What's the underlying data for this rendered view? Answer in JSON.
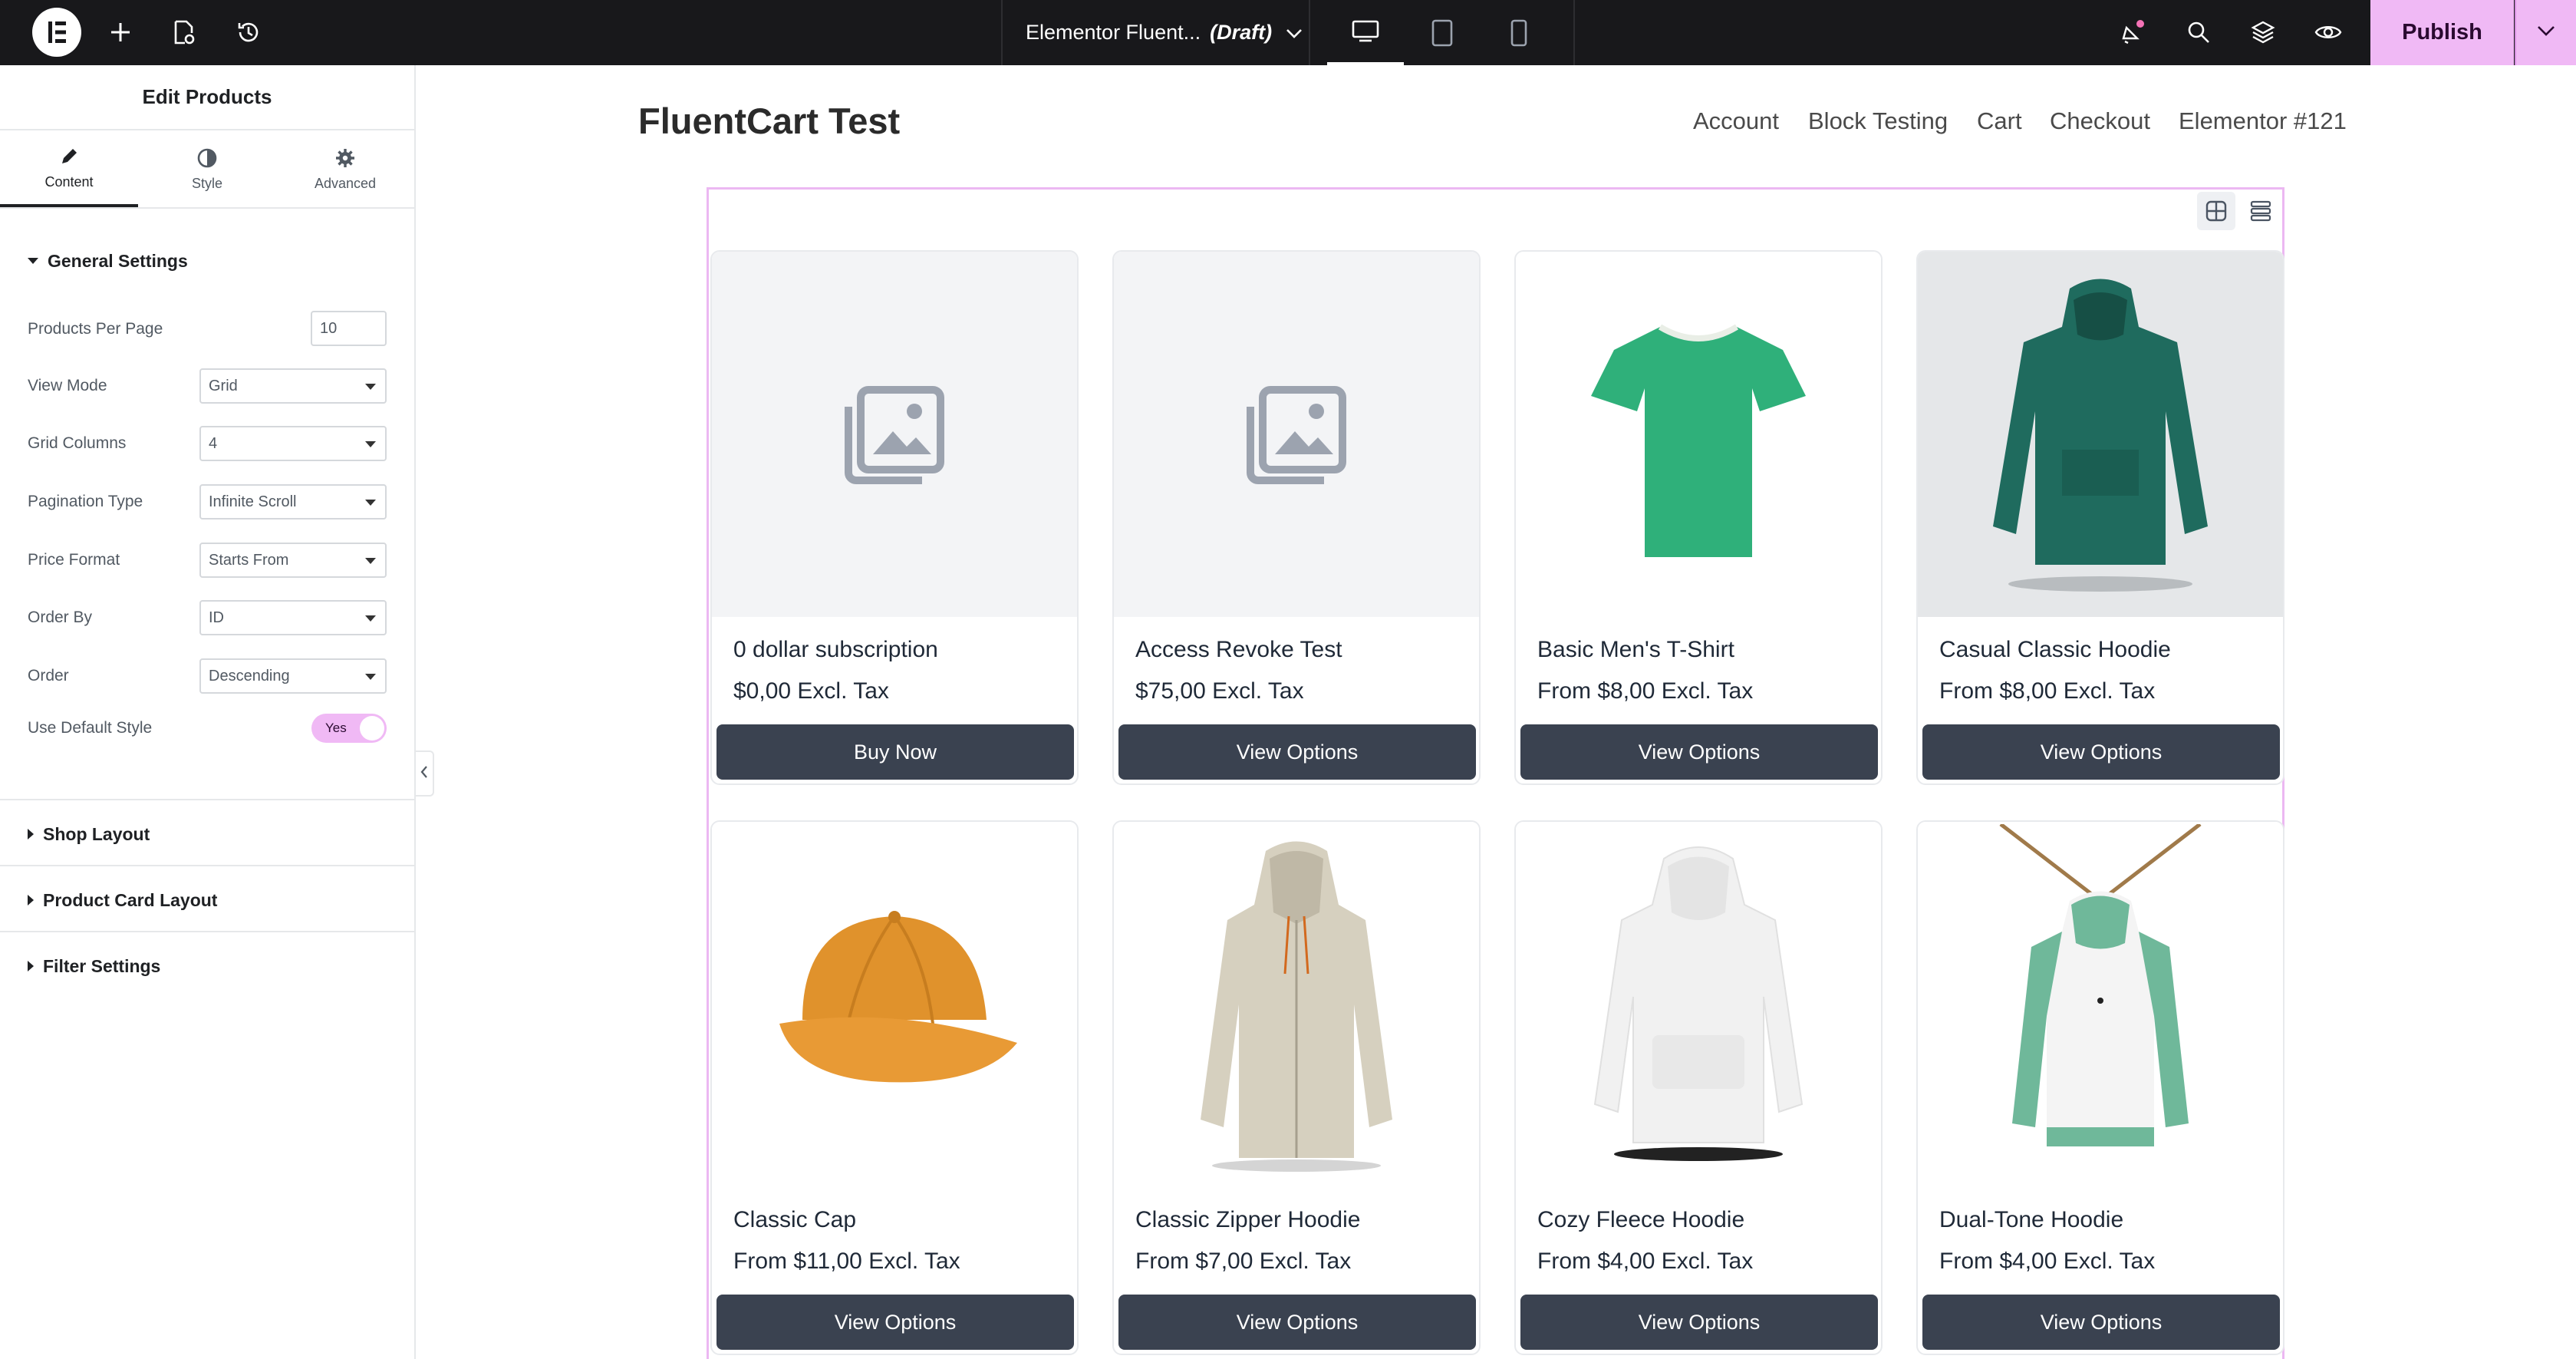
{
  "topbar": {
    "document_title": "Elementor Fluent...",
    "document_status": "(Draft)",
    "publish_label": "Publish"
  },
  "panel": {
    "title": "Edit Products",
    "tabs": [
      {
        "label": "Content",
        "icon": "pencil-icon"
      },
      {
        "label": "Style",
        "icon": "half-circle-icon"
      },
      {
        "label": "Advanced",
        "icon": "gear-icon"
      }
    ],
    "general_settings": {
      "heading": "General Settings",
      "products_per_page": {
        "label": "Products Per Page",
        "value": "10"
      },
      "view_mode": {
        "label": "View Mode",
        "value": "Grid"
      },
      "grid_columns": {
        "label": "Grid Columns",
        "value": "4"
      },
      "pagination_type": {
        "label": "Pagination Type",
        "value": "Infinite Scroll"
      },
      "price_format": {
        "label": "Price Format",
        "value": "Starts From"
      },
      "order_by": {
        "label": "Order By",
        "value": "ID"
      },
      "order": {
        "label": "Order",
        "value": "Descending"
      },
      "use_default_style": {
        "label": "Use Default Style",
        "value": "Yes"
      }
    },
    "sections": [
      "Shop Layout",
      "Product Card Layout",
      "Filter Settings"
    ]
  },
  "site": {
    "title": "FluentCart Test",
    "menu": [
      "Account",
      "Block Testing",
      "Cart",
      "Checkout",
      "Elementor #121"
    ]
  },
  "products": [
    {
      "name": "0 dollar subscription",
      "price": "$0,00 Excl. Tax",
      "button": "Buy Now",
      "image": "placeholder-image-icon"
    },
    {
      "name": "Access Revoke Test",
      "price": "$75,00 Excl. Tax",
      "button": "View Options",
      "image": "placeholder-image-icon"
    },
    {
      "name": "Basic Men's T-Shirt",
      "price": "From $8,00 Excl. Tax",
      "button": "View Options",
      "image": "tshirt-image"
    },
    {
      "name": "Casual Classic Hoodie",
      "price": "From $8,00 Excl. Tax",
      "button": "View Options",
      "image": "hoodie-image"
    },
    {
      "name": "Classic Cap",
      "price": "From $11,00 Excl. Tax",
      "button": "View Options",
      "image": "cap-image"
    },
    {
      "name": "Classic Zipper Hoodie",
      "price": "From $7,00 Excl. Tax",
      "button": "View Options",
      "image": "zipper-hoodie-image"
    },
    {
      "name": "Cozy Fleece Hoodie",
      "price": "From $4,00 Excl. Tax",
      "button": "View Options",
      "image": "fleece-hoodie-image"
    },
    {
      "name": "Dual-Tone Hoodie",
      "price": "From $4,00 Excl. Tax",
      "button": "View Options",
      "image": "dual-tone-hoodie-image"
    }
  ],
  "colors": {
    "topbar_bg": "#18181b",
    "accent_pink": "#f0b9f5",
    "button_dark": "#3a4250",
    "widget_outline": "#ecb8f2"
  }
}
